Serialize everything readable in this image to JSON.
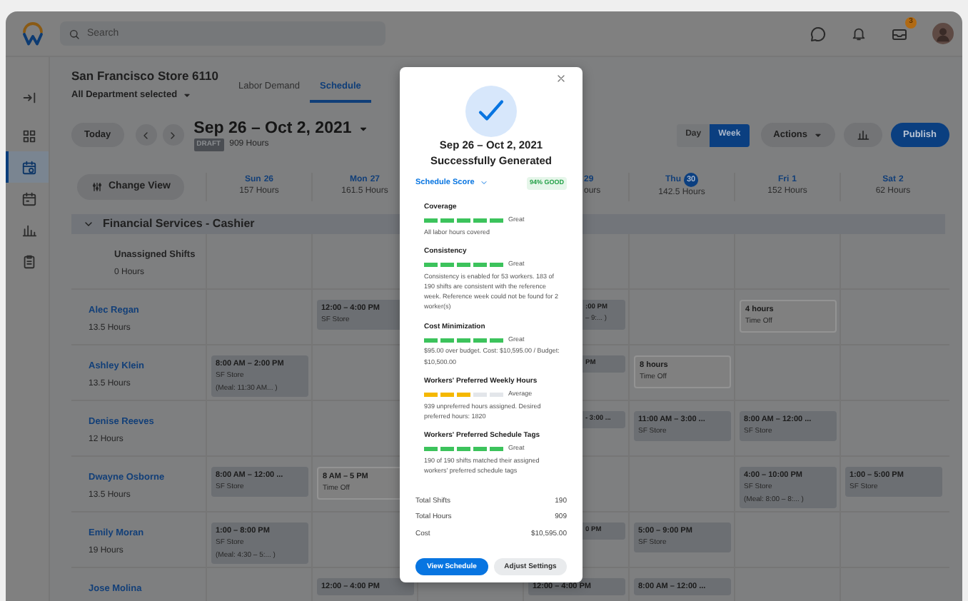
{
  "topbar": {
    "search": {
      "placeholder": "Search"
    },
    "inbox_badge": "3"
  },
  "sidebar": {
    "items": [
      {
        "selected": false
      },
      {
        "selected": false
      },
      {
        "selected": true
      },
      {
        "selected": false
      },
      {
        "selected": false
      },
      {
        "selected": false
      }
    ]
  },
  "header": {
    "store": "San Francisco Store 6110",
    "department": "All Department selected",
    "tabs": [
      {
        "label": "Labor Demand",
        "selected": false
      },
      {
        "label": "Schedule",
        "selected": true
      }
    ]
  },
  "toolbar": {
    "today": "Today",
    "date_range": "Sep 26 – Oct 2, 2021",
    "status": "DRAFT",
    "hours": "909 Hours",
    "view_modes": [
      {
        "label": "Day",
        "selected": false
      },
      {
        "label": "Week",
        "selected": true
      }
    ],
    "actions": "Actions",
    "publish": "Publish"
  },
  "schedule": {
    "change_view": "Change View",
    "days": {
      "sun": {
        "day": "Sun",
        "date": "26",
        "hours": "157 Hours",
        "today": false,
        "covered": false
      },
      "mon": {
        "day": "Mon",
        "date": "27",
        "hours": "161.5 Hours",
        "today": false,
        "covered": false
      },
      "wed": {
        "date": "29",
        "hours": "ours",
        "today": false,
        "covered": true
      },
      "thu": {
        "day": "Thu",
        "date": "30",
        "hours": "142.5 Hours",
        "today": true,
        "covered": false
      },
      "fri": {
        "day": "Fri",
        "date": "1",
        "hours": "152 Hours",
        "today": false,
        "covered": false
      },
      "sat": {
        "day": "Sat",
        "date": "2",
        "hours": "62 Hours",
        "today": false,
        "covered": false
      }
    },
    "group": {
      "title": "Financial Services - Cashier",
      "expanded": true
    },
    "rows": [
      {
        "kind": "unassigned",
        "name": "Unassigned Shifts",
        "hours": "0 Hours"
      },
      {
        "kind": "worker",
        "name": "Alec Regan",
        "hours": "13.5 Hours",
        "shifts": {
          "mon": {
            "kind": "shift",
            "covered": false,
            "lines": [
              "12:00 – 4:00 PM",
              "SF Store"
            ]
          },
          "wed": {
            "kind": "shift",
            "covered": true,
            "lines": [
              ":00 PM",
              "– 9:... )"
            ]
          },
          "fri": {
            "kind": "time_off",
            "covered": false,
            "lines": [
              "4 hours",
              "Time Off"
            ]
          }
        }
      },
      {
        "kind": "worker",
        "name": "Ashley Klein",
        "hours": "13.5 Hours",
        "shifts": {
          "sun": {
            "kind": "shift",
            "covered": false,
            "lines": [
              "8:00 AM – 2:00 PM",
              "SF Store",
              "(Meal: 11:30 AM... )"
            ]
          },
          "wed": {
            "kind": "shift",
            "covered": true,
            "lines": [
              "PM"
            ]
          },
          "thu": {
            "kind": "time_off",
            "covered": false,
            "lines": [
              "8 hours",
              "Time Off"
            ]
          }
        }
      },
      {
        "kind": "worker",
        "name": "Denise Reeves",
        "hours": "12 Hours",
        "shifts": {
          "wed": {
            "kind": "shift",
            "covered": true,
            "lines": [
              "- 3:00 ..."
            ]
          },
          "thu": {
            "kind": "shift",
            "covered": false,
            "lines": [
              "11:00 AM – 3:00 ...",
              "SF Store"
            ]
          },
          "fri": {
            "kind": "shift",
            "covered": false,
            "lines": [
              "8:00 AM – 12:00 ...",
              "SF Store"
            ]
          }
        }
      },
      {
        "kind": "worker",
        "name": "Dwayne Osborne",
        "hours": "13.5 Hours",
        "shifts": {
          "sun": {
            "kind": "shift",
            "covered": false,
            "lines": [
              "8:00 AM – 12:00 ...",
              "SF Store"
            ]
          },
          "mon": {
            "kind": "time_off",
            "covered": false,
            "lines": [
              "8 AM – 5 PM",
              "Time Off"
            ]
          },
          "fri": {
            "kind": "shift",
            "covered": false,
            "lines": [
              "4:00 – 10:00 PM",
              "SF Store",
              "(Meal: 8:00 – 8:... )"
            ]
          },
          "sat": {
            "kind": "shift",
            "covered": false,
            "lines": [
              "1:00 – 5:00 PM",
              "SF Store"
            ]
          }
        }
      },
      {
        "kind": "worker",
        "name": "Emily Moran",
        "hours": "19 Hours",
        "shifts": {
          "sun": {
            "kind": "shift",
            "covered": false,
            "lines": [
              "1:00 – 8:00 PM",
              "SF Store",
              "(Meal: 4:30 – 5:... )"
            ]
          },
          "wed": {
            "kind": "shift",
            "covered": true,
            "lines": [
              "0 PM"
            ]
          },
          "thu": {
            "kind": "shift",
            "covered": false,
            "lines": [
              "5:00 – 9:00 PM",
              "SF Store"
            ]
          }
        }
      },
      {
        "kind": "worker",
        "name": "Jose Molina",
        "shifts": {
          "mon": {
            "kind": "shift",
            "covered": false,
            "lines": [
              "12:00 – 4:00 PM"
            ]
          },
          "wed": {
            "kind": "shift",
            "covered": false,
            "lines": [
              "12:00 – 4:00 PM"
            ]
          },
          "thu": {
            "kind": "shift",
            "covered": false,
            "lines": [
              "8:00 AM – 12:00 ..."
            ]
          }
        }
      }
    ]
  },
  "dialog": {
    "title": "Sep 26 – Oct 2, 2021",
    "subtitle": "Successfully Generated",
    "score_label": "Schedule Score",
    "score": "94% GOOD",
    "metrics": [
      {
        "name": "Coverage",
        "level": 1,
        "rating": "Great",
        "description": "All labor hours covered"
      },
      {
        "name": "Consistency",
        "level": 1,
        "rating": "Great",
        "description": "Consistency is enabled for 53 workers. 183 of 190 shifts are consistent with the reference week. Reference week could not be found for 2 worker(s)"
      },
      {
        "name": "Cost Minimization",
        "level": 1,
        "rating": "Great",
        "description": "$95.00 over budget. Cost: $10,595.00 / Budget: $10,500.00"
      },
      {
        "name": "Workers' Preferred Weekly Hours",
        "level": 0.6,
        "rating": "Average",
        "description": "939 unpreferred hours assigned. Desired preferred hours: 1820"
      },
      {
        "name": "Workers' Preferred Schedule Tags",
        "level": 1,
        "rating": "Great",
        "description": "190 of 190 shifts matched their assigned workers' preferred schedule tags"
      }
    ],
    "totals": [
      {
        "label": "Total Shifts",
        "value": "190"
      },
      {
        "label": "Total Hours",
        "value": "909"
      },
      {
        "label": "Cost",
        "value": "$10,595.00"
      }
    ],
    "buttons": [
      {
        "label": "View Schedule",
        "kind": "primary"
      },
      {
        "label": "Adjust Settings",
        "kind": "secondary"
      }
    ]
  }
}
